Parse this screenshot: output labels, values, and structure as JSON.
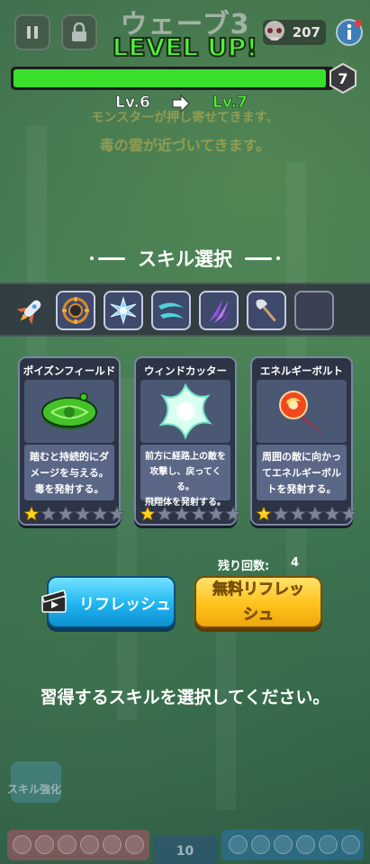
{
  "hud": {
    "wave_title": "ウェーブ3",
    "coin_count": "207",
    "pause_icon": "pause-icon",
    "lock_icon": "lock-icon",
    "info_icon": "info-icon"
  },
  "level_up": {
    "banner": "LEVEL UP!",
    "xp_progress_fraction": 0.98,
    "level_badge": "7",
    "from_level": "Lv.6",
    "to_level": "Lv.7"
  },
  "wave_messages": {
    "line1": "モンスターが押し寄せてきます、",
    "line2": "毒の雲が近づいてきます。"
  },
  "skill_select": {
    "title": "スキル選択",
    "owned_slots": [
      {
        "icon": "shield-ring-icon",
        "filled": true
      },
      {
        "icon": "ice-burst-icon",
        "filled": true
      },
      {
        "icon": "wind-blade-icon",
        "filled": true
      },
      {
        "icon": "claw-icon",
        "filled": true
      },
      {
        "icon": "axe-icon",
        "filled": true
      },
      {
        "icon": "empty-slot",
        "filled": false
      }
    ],
    "weapon_icon": "rocket-icon",
    "cards": [
      {
        "title": "ポイズンフィールド",
        "icon": "poison-field-icon",
        "desc": "踏むと持続的にダメージを与える。毒を発射する。",
        "desc_lines": [
          "踏むと持続的にダ",
          "メージを与える。",
          "毒を発射する。"
        ],
        "stars_filled": 1,
        "stars_total": 6
      },
      {
        "title": "ウィンドカッター",
        "icon": "wind-cutter-icon",
        "desc_lines": [
          "前方に経路上の敵を",
          "攻撃し、戻ってくる。",
          "飛翔体を発射する。"
        ],
        "stars_filled": 1,
        "stars_total": 6
      },
      {
        "title": "エネルギーボルト",
        "icon": "energy-bolt-icon",
        "desc_lines": [
          "周囲の敵に向かっ",
          "てエネルギーボル",
          "トを発射する。"
        ],
        "stars_filled": 1,
        "stars_total": 6
      }
    ]
  },
  "refresh": {
    "remaining_label": "残り回数:",
    "remaining_count": "4",
    "refresh_label": "リフレッシュ",
    "refresh_icon": "clapperboard-icon",
    "free_refresh_line1": "無料リフレッ",
    "free_refresh_line2": "シュ"
  },
  "instruction": "習得するスキルを選択してください。",
  "bottom_hud": {
    "skill_upgrade_label": "スキル強化",
    "center_counter": "10"
  },
  "colors": {
    "level_green": "#4df23a",
    "refresh_blue": "#1eb4ef",
    "free_refresh_yellow": "#ffc21b",
    "card_bg": "#2c3446",
    "star_gold": "#ffd21f"
  }
}
